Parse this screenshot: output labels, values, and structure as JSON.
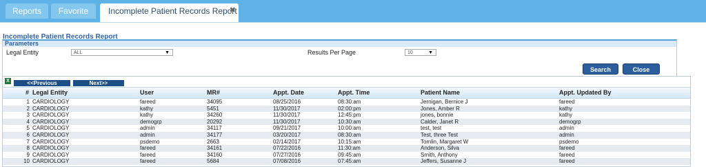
{
  "tabs": {
    "reports": "Reports",
    "favorite": "Favorite",
    "active": "Incomplete Patient Records Report",
    "close_glyph": "✖"
  },
  "report_title": "Incomplete Patient Records Report",
  "parameters": {
    "heading": "Parameters",
    "legal_entity_label": "Legal Entity",
    "legal_entity_value": "ALL",
    "results_per_page_label": "Results Per Page",
    "results_per_page_value": "10"
  },
  "buttons": {
    "search": "Search",
    "close": "Close"
  },
  "pagination": {
    "previous": "<<Previous",
    "next": "Next>>"
  },
  "table": {
    "columns": [
      "#",
      "Legal Entity",
      "User",
      "MR#",
      "Appt. Date",
      "Appt. Time",
      "Patient Name",
      "Appt. Updated By"
    ],
    "rows": [
      [
        "1",
        "CARDIOLOGY",
        "fareed",
        "34095",
        "08/25/2016",
        "08:30:am",
        "Jernigan, Bernice J",
        "fareed"
      ],
      [
        "2",
        "CARDIOLOGY",
        "kathy",
        "5451",
        "11/30/2017",
        "02:00:pm",
        "Jones, Amber R",
        "kathy"
      ],
      [
        "3",
        "CARDIOLOGY",
        "kathy",
        "34260",
        "11/30/2017",
        "12:45:pm",
        "jones, bonnie",
        "kathy"
      ],
      [
        "4",
        "CARDIOLOGY",
        "demogrp",
        "20292",
        "11/30/2017",
        "10:30:am",
        "Calder, Janet R",
        "demogrp"
      ],
      [
        "5",
        "CARDIOLOGY",
        "admin",
        "34117",
        "09/21/2017",
        "10:00:am",
        "test, test",
        "admin"
      ],
      [
        "6",
        "CARDIOLOGY",
        "admin",
        "34177",
        "03/20/2017",
        "08:30:am",
        "Test, three Test",
        "admin"
      ],
      [
        "7",
        "CARDIOLOGY",
        "psdemo",
        "2663",
        "02/14/2017",
        "10:15:am",
        "Tomlin, Margaret W",
        "psdemo"
      ],
      [
        "8",
        "CARDIOLOGY",
        "fareed",
        "34161",
        "07/22/2016",
        "11:30:am",
        "Anderson, Silva",
        "fareed"
      ],
      [
        "9",
        "CARDIOLOGY",
        "fareed",
        "34160",
        "07/27/2016",
        "09:45:am",
        "Smith, Anthony",
        "fareed"
      ],
      [
        "10",
        "CARDIOLOGY",
        "fareed",
        "5684",
        "07/08/2016",
        "07:45:am",
        "Jeffers, Susanne J",
        "fareed"
      ]
    ]
  }
}
